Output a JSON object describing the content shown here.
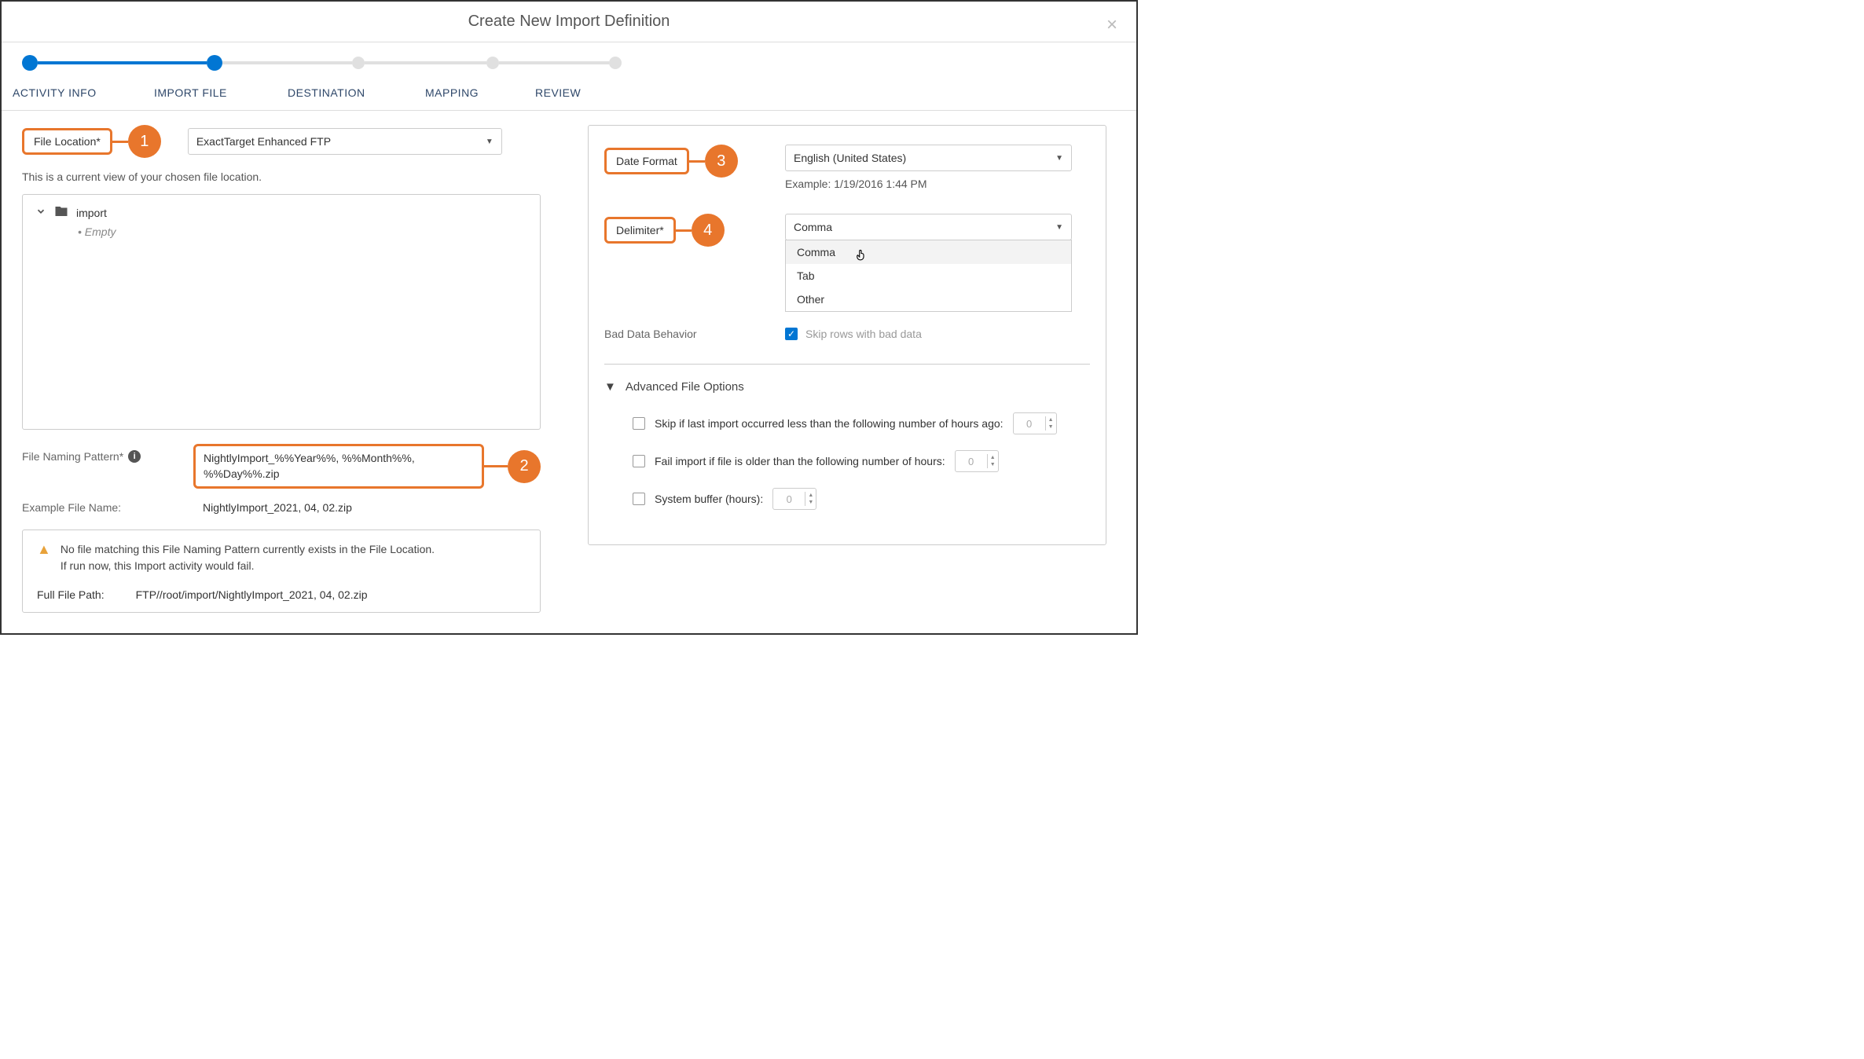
{
  "header": {
    "title": "Create New Import Definition"
  },
  "steps": {
    "s1": "ACTIVITY INFO",
    "s2": "IMPORT FILE",
    "s3": "DESTINATION",
    "s4": "MAPPING",
    "s5": "REVIEW"
  },
  "callouts": {
    "n1": "1",
    "n2": "2",
    "n3": "3",
    "n4": "4"
  },
  "left": {
    "file_location_label": "File Location*",
    "file_location_value": "ExactTarget Enhanced FTP",
    "file_loc_desc": "This is a current view of your chosen file location.",
    "tree_root": "import",
    "tree_empty": "Empty",
    "naming_label": "File Naming Pattern*",
    "naming_value": "NightlyImport_%%Year%%, %%Month%%, %%Day%%.zip",
    "example_label": "Example File Name:",
    "example_value": "NightlyImport_2021, 04, 02.zip",
    "warn_line1": "No file matching this File Naming Pattern currently exists in the File Location.",
    "warn_line2": "If run now, this Import activity would fail.",
    "path_label": "Full File Path:",
    "path_value": "FTP//root/import/NightlyImport_2021, 04, 02.zip"
  },
  "right": {
    "date_format_label": "Date Format",
    "date_format_value": "English (United States)",
    "date_example": "Example: 1/19/2016 1:44 PM",
    "delimiter_label": "Delimiter*",
    "delimiter_value": "Comma",
    "delimiter_opts": {
      "o1": "Comma",
      "o2": "Tab",
      "o3": "Other"
    },
    "bad_data_label": "Bad Data Behavior",
    "bad_data_value": "Skip rows with bad data",
    "adv_title": "Advanced File Options",
    "adv1": "Skip if last import occurred less than the following number of hours ago:",
    "adv2": "Fail import if file is older than the following number of hours:",
    "adv3": "System buffer (hours):",
    "num_default": "0"
  }
}
